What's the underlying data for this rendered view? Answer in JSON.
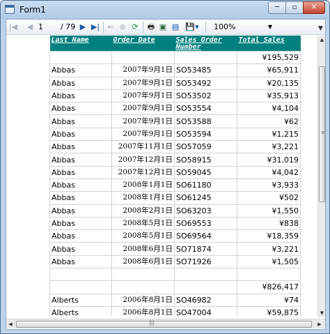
{
  "window": {
    "title": "Form1",
    "minimize": "─",
    "maximize": "▫",
    "close": "✕"
  },
  "toolbar": {
    "first": "|◀",
    "prev": "◀",
    "page_current": "1",
    "page_total": "/ 79",
    "next": "▶",
    "last": "▶|",
    "back": "⇐",
    "stop": "⊗",
    "refresh": "⟳",
    "print": "🖶",
    "layout": "▣",
    "page_setup": "▤",
    "export": "💾▾",
    "zoom": "100%",
    "zoom_arrow": "▼",
    "chevron": "▼"
  },
  "table": {
    "headers": [
      "Last Name",
      "Order Date",
      "Sales Order Number",
      "Total Sales"
    ],
    "rows": [
      [
        "",
        "",
        "",
        "¥195,529"
      ],
      [
        "Abbas",
        "2007年9月1日",
        "SO53485",
        "¥65,911"
      ],
      [
        "Abbas",
        "2007年9月1日",
        "SO53492",
        "¥20,135"
      ],
      [
        "Abbas",
        "2007年9月1日",
        "SO53502",
        "¥35,913"
      ],
      [
        "Abbas",
        "2007年9月1日",
        "SO53554",
        "¥4,104"
      ],
      [
        "Abbas",
        "2007年9月1日",
        "SO53588",
        "¥62"
      ],
      [
        "Abbas",
        "2007年9月1日",
        "SO53594",
        "¥1,215"
      ],
      [
        "Abbas",
        "2007年11月1日",
        "SO57059",
        "¥3,221"
      ],
      [
        "Abbas",
        "2007年12月1日",
        "SO58915",
        "¥31,019"
      ],
      [
        "Abbas",
        "2007年12月1日",
        "SO59045",
        "¥4,042"
      ],
      [
        "Abbas",
        "2008年1月1日",
        "SO61180",
        "¥3,933"
      ],
      [
        "Abbas",
        "2008年1月1日",
        "SO61245",
        "¥502"
      ],
      [
        "Abbas",
        "2008年2月1日",
        "SO63203",
        "¥1,550"
      ],
      [
        "Abbas",
        "2008年5月1日",
        "SO69553",
        "¥838"
      ],
      [
        "Abbas",
        "2008年5月1日",
        "SO69564",
        "¥18,359"
      ],
      [
        "Abbas",
        "2008年6月1日",
        "SO71874",
        "¥3,221"
      ],
      [
        "Abbas",
        "2008年6月1日",
        "SO71926",
        "¥1,505"
      ],
      [
        "",
        "",
        "",
        ""
      ],
      [
        "",
        "",
        "",
        "¥826,417"
      ],
      [
        "Alberts",
        "2006年8月1日",
        "SO46982",
        "¥74"
      ],
      [
        "Alberts",
        "2006年8月1日",
        "SO47004",
        "¥59,875"
      ],
      [
        "",
        "",
        "",
        ""
      ]
    ]
  },
  "scrollbars": {
    "up": "▲",
    "down": "▼",
    "left": "◀",
    "right": "▶",
    "vgrip": "≡",
    "hgrip": "|||"
  }
}
